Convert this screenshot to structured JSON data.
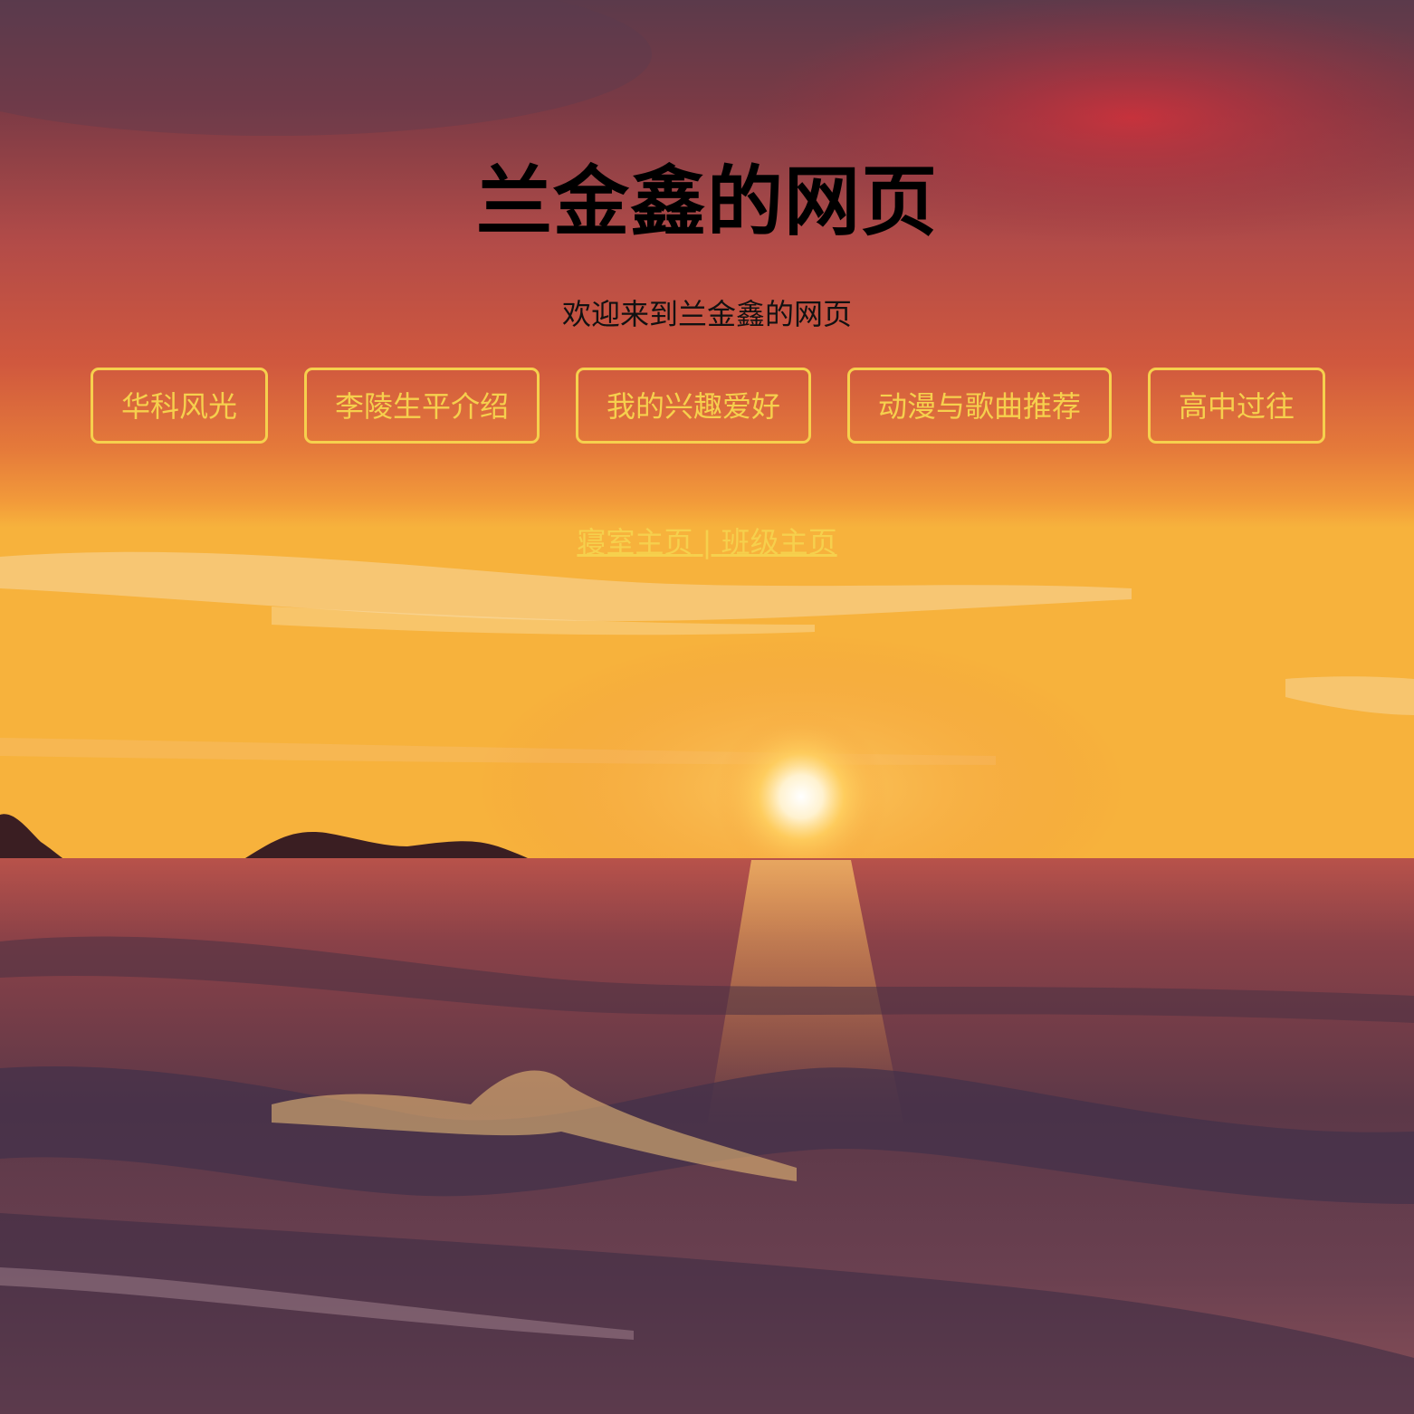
{
  "page": {
    "title": "兰金鑫的网页",
    "subtitle": "欢迎来到兰金鑫的网页"
  },
  "nav": {
    "items": [
      {
        "label": "华科风光"
      },
      {
        "label": "李陵生平介绍"
      },
      {
        "label": "我的兴趣爱好"
      },
      {
        "label": "动漫与歌曲推荐"
      },
      {
        "label": "高中过往"
      }
    ]
  },
  "footer": {
    "dorm_link": "寝室主页",
    "separator": " | ",
    "class_link": "班级主页"
  },
  "colors": {
    "accent": "#f6d04d",
    "title": "#000000",
    "sky_top": "#5a3c4c",
    "sky_mid": "#c0504a",
    "horizon": "#f5a23a",
    "sea": "#5a3a4a"
  },
  "background": {
    "scene": "sunset-over-sea"
  }
}
